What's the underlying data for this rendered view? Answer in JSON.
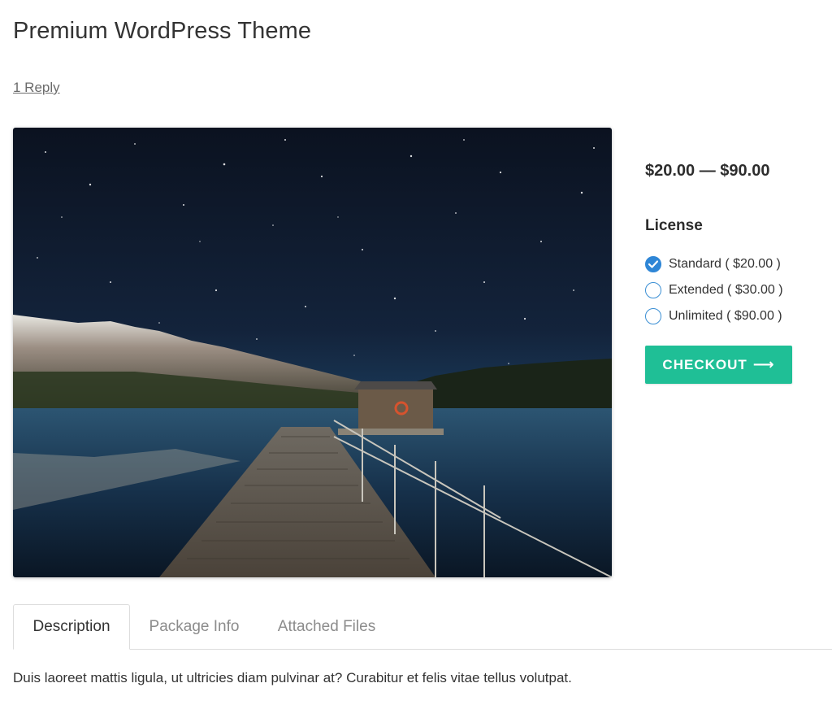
{
  "page": {
    "title": "Premium WordPress Theme",
    "reply_link": "1 Reply"
  },
  "product": {
    "image_alt": "Night sky with stars above a wooden pier and boathouse on a mountain lake",
    "price_range": "$20.00 — $90.00",
    "license_title": "License",
    "license_options": [
      {
        "label": "Standard ( $20.00 )",
        "selected": true
      },
      {
        "label": "Extended ( $30.00 )",
        "selected": false
      },
      {
        "label": "Unlimited ( $90.00 )",
        "selected": false
      }
    ],
    "checkout_label": "CHECKOUT",
    "checkout_icon": "arrow-right-icon"
  },
  "tabs": [
    {
      "label": "Description",
      "active": true
    },
    {
      "label": "Package Info",
      "active": false
    },
    {
      "label": "Attached Files",
      "active": false
    }
  ],
  "description": "Duis laoreet mattis ligula, ut ultricies diam pulvinar at? Curabitur et felis vitae tellus volutpat.",
  "colors": {
    "accent": "#1fbf96",
    "radio_selected": "#2f86d6",
    "text": "#333333",
    "muted_text": "#8c8c8c"
  }
}
